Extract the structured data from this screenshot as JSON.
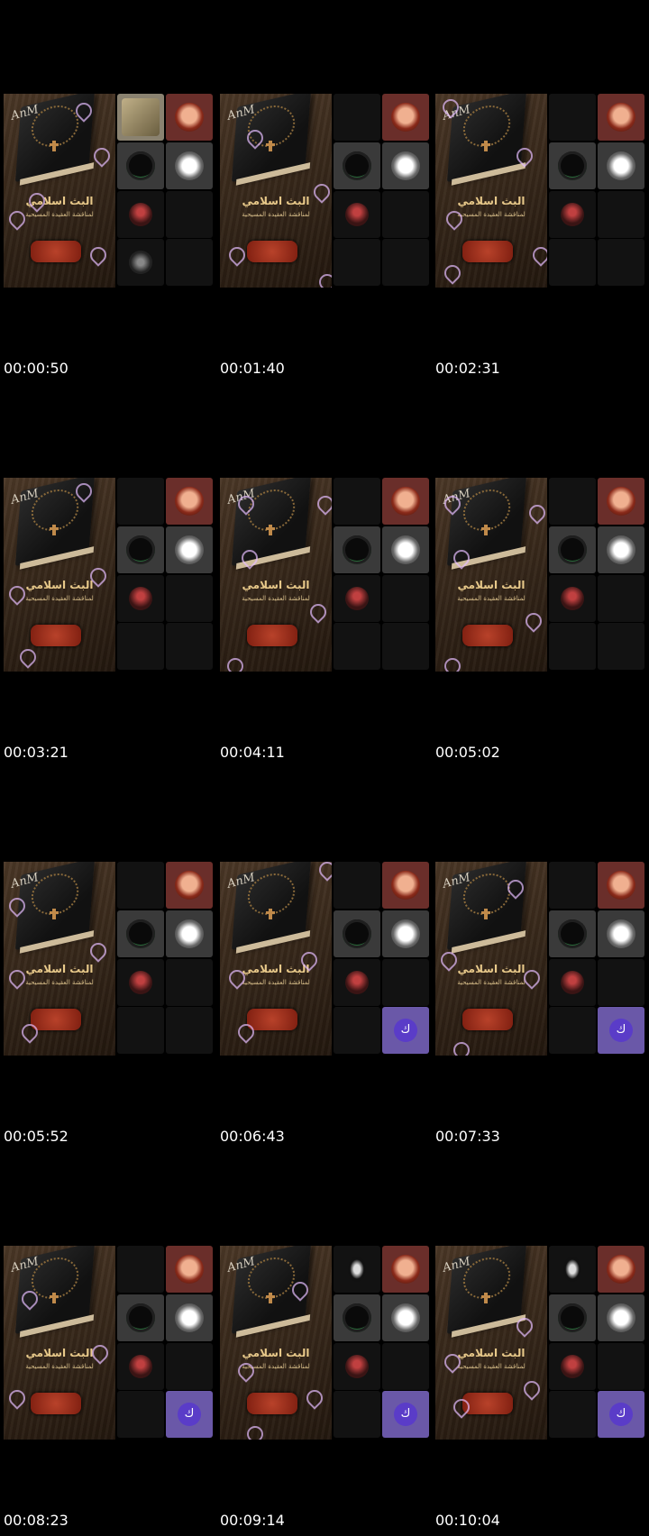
{
  "cover": {
    "title": "البث اسلامي",
    "subtitle": "لمناقشة العقيدة المسيحية",
    "logo": "AnM"
  },
  "tile_icons": {
    "person": "person-avatar-icon",
    "bird": "bird-avatar-icon",
    "ring": "ring-avatar-icon",
    "red": "red-avatar-icon",
    "grey": "grey-avatar-icon",
    "ghost": "ghost-avatar-icon",
    "photo": "photo-avatar-icon",
    "purple": "purple-letter-avatar-icon"
  },
  "purple_letter": "ك",
  "colors": {
    "background": "#000000",
    "purple_tile": "#6a58a8",
    "cover_text": "#e8c98a"
  },
  "frames": [
    {
      "timestamp": "00:00:50"
    },
    {
      "timestamp": "00:01:40"
    },
    {
      "timestamp": "00:02:31"
    },
    {
      "timestamp": "00:03:21"
    },
    {
      "timestamp": "00:04:11"
    },
    {
      "timestamp": "00:05:02"
    },
    {
      "timestamp": "00:05:52"
    },
    {
      "timestamp": "00:06:43"
    },
    {
      "timestamp": "00:07:33"
    },
    {
      "timestamp": "00:08:23"
    },
    {
      "timestamp": "00:09:14"
    },
    {
      "timestamp": "00:10:04"
    }
  ]
}
